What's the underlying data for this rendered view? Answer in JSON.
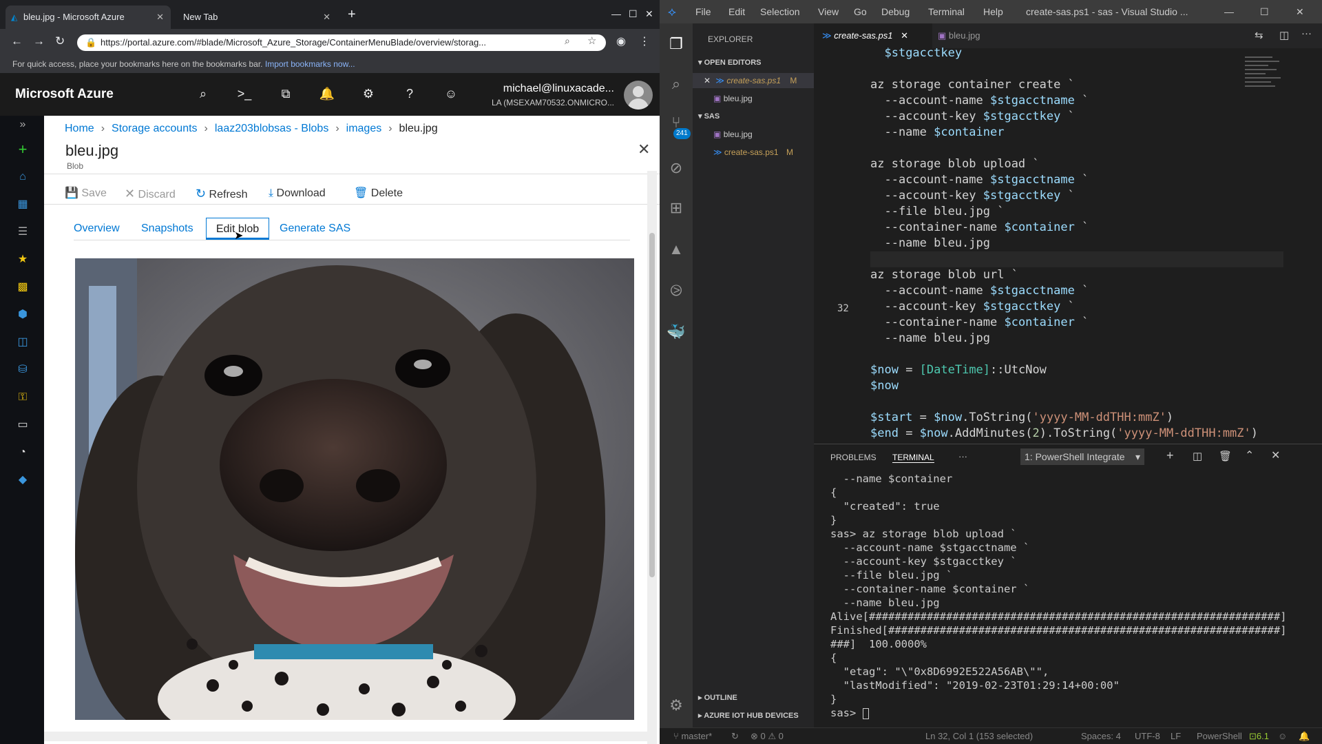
{
  "browser": {
    "tabs": [
      {
        "label": "bleu.jpg - Microsoft Azure"
      },
      {
        "label": "New Tab"
      }
    ],
    "url": "https://portal.azure.com/#blade/Microsoft_Azure_Storage/ContainerMenuBlade/overview/storag...",
    "bookmarks_text": "For quick access, place your bookmarks here on the bookmarks bar.",
    "bookmarks_link": "Import bookmarks now..."
  },
  "azure": {
    "brand": "Microsoft Azure",
    "user_name": "michael@linuxacade...",
    "user_dir": "LA (MSEXAM70532.ONMICRO...",
    "breadcrumb": [
      "Home",
      "Storage accounts",
      "laaz203blobsas - Blobs",
      "images",
      "bleu.jpg"
    ],
    "blob_title": "bleu.jpg",
    "blob_subtitle": "Blob",
    "commands": [
      "Save",
      "Discard",
      "Refresh",
      "Download",
      "Delete"
    ],
    "tabs": [
      "Overview",
      "Snapshots",
      "Edit blob",
      "Generate SAS"
    ],
    "active_tab": "Edit blob"
  },
  "vscode": {
    "menu": [
      "File",
      "Edit",
      "Selection",
      "View",
      "Go",
      "Debug",
      "Terminal",
      "Help"
    ],
    "window_title": "create-sas.ps1 - sas - Visual Studio ...",
    "scm_badge": "241",
    "explorer_title": "EXPLORER",
    "open_editors_label": "OPEN EDITORS",
    "open_editors": [
      {
        "name": "create-sas.ps1",
        "badge": "M"
      },
      {
        "name": "bleu.jpg",
        "badge": ""
      }
    ],
    "folder_label": "SAS",
    "folder_files": [
      {
        "name": "bleu.jpg",
        "badge": ""
      },
      {
        "name": "create-sas.ps1",
        "badge": "M"
      }
    ],
    "outline_label": "OUTLINE",
    "iot_label": "AZURE IOT HUB DEVICES",
    "editor_tabs": [
      "create-sas.ps1",
      "bleu.jpg"
    ],
    "code_lines": [
      "  $stgacctkey",
      "",
      "az storage container create `",
      "  --account-name $stgacctname `",
      "  --account-key $stgacctkey `",
      "  --name $container",
      "",
      "az storage blob upload `",
      "  --account-name $stgacctname `",
      "  --account-key $stgacctkey `",
      "  --file bleu.jpg `",
      "  --container-name $container `",
      "  --name bleu.jpg",
      "",
      "az storage blob url `",
      "  --account-name $stgacctname `",
      "  --account-key $stgacctkey `",
      "  --container-name $container `",
      "  --name bleu.jpg",
      "",
      "$now = [DateTime]::UtcNow",
      "$now",
      "",
      "$start = $now.ToString('yyyy-MM-ddTHH:mmZ')",
      "$end = $now.AddMinutes(2).ToString('yyyy-MM-ddTHH:mmZ')"
    ],
    "current_line_number": "32",
    "panel_tabs": [
      "PROBLEMS",
      "TERMINAL",
      "···"
    ],
    "terminal_select": "1: PowerShell Integrate",
    "terminal_lines": [
      "  --name $container",
      "{",
      "  \"created\": true",
      "}",
      "sas> az storage blob upload `",
      "  --account-name $stgacctname `",
      "  --account-key $stgacctkey `",
      "  --file bleu.jpg `",
      "  --container-name $container `",
      "  --name bleu.jpg",
      "Alive[################################################################]",
      "Finished[#############################################################]",
      "###]  100.0000%",
      "{",
      "  \"etag\": \"\\\"0x8D6992E522A56AB\\\"\",",
      "  \"lastModified\": \"2019-02-23T01:29:14+00:00\"",
      "}",
      "sas> "
    ],
    "status": {
      "branch": "master*",
      "errors": "0",
      "warnings": "0",
      "position": "Ln 32, Col 1 (153 selected)",
      "spaces": "Spaces: 4",
      "encoding": "UTF-8",
      "eol": "LF",
      "language": "PowerShell",
      "version": "6.1"
    }
  },
  "colors": {
    "azure_blue": "#0078d4",
    "vscode_blue": "#007acc"
  }
}
